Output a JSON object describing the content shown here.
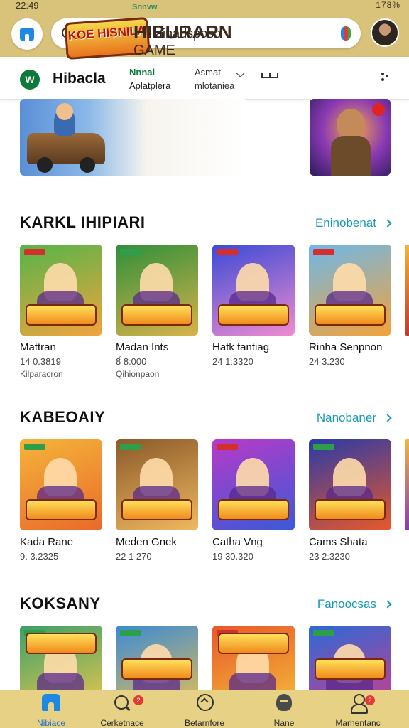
{
  "status": {
    "time": "22:49",
    "battery": "178%"
  },
  "search": {
    "query": "Marketplace ainadsposo"
  },
  "header": {
    "brand": "Hibacla",
    "logo_text": "W",
    "tab1_line1": "Nnnal",
    "tab1_line2": "Aplatplera",
    "tab2_line1": "Asmat",
    "tab2_line2": "mlotaniea"
  },
  "hero": {
    "logo_text": "KOE HISNILA",
    "tag": "Snnvw",
    "title": "HIBURARN",
    "subtitle": "GAME"
  },
  "sections": [
    {
      "title": "KARKL IHIPIARI",
      "link": "Eninobenat",
      "cards": [
        {
          "name": "Mattran",
          "num": "14 0.3819",
          "sub": "Kilparacron",
          "colors": [
            "#53b54a",
            "#f3a33c"
          ]
        },
        {
          "name": "Madan Ints",
          "num": "8́ 8:000",
          "sub": "Qihionpaon",
          "colors": [
            "#2f8f3a",
            "#d8b24a"
          ]
        },
        {
          "name": "Hatk fantiag",
          "num": "24 1:3320",
          "sub": "",
          "colors": [
            "#3a4bd6",
            "#f08bd0"
          ]
        },
        {
          "name": "Rinha Senpnon",
          "num": "24 3.230",
          "sub": "",
          "colors": [
            "#6db8ea",
            "#f4a23a"
          ]
        }
      ]
    },
    {
      "title": "KABEOAIY",
      "link": "Nanobaner",
      "cards": [
        {
          "name": "Kada Rane",
          "num": "9. 3.2325",
          "sub": "",
          "colors": [
            "#f5b43a",
            "#e96a2a"
          ]
        },
        {
          "name": "Meden Gnek",
          "num": "22 1 270",
          "sub": "",
          "colors": [
            "#8a5a2a",
            "#f0b860"
          ]
        },
        {
          "name": "Catha Vng",
          "num": "19 30.320",
          "sub": "",
          "colors": [
            "#b83ac8",
            "#3a5ad6"
          ]
        },
        {
          "name": "Cams Shata",
          "num": "23 2:3230",
          "sub": "",
          "colors": [
            "#2a3aa8",
            "#e8582a"
          ]
        }
      ]
    },
    {
      "title": "KOKSANY",
      "link": "Fanoocsas",
      "cards": [
        {
          "name": "",
          "num": "",
          "sub": "",
          "colors": [
            "#3aa06a",
            "#f5c94a"
          ]
        },
        {
          "name": "",
          "num": "",
          "sub": "",
          "colors": [
            "#3a8ad6",
            "#f2c24a"
          ]
        },
        {
          "name": "",
          "num": "",
          "sub": "",
          "colors": [
            "#e8582a",
            "#f5c23a"
          ]
        },
        {
          "name": "",
          "num": "",
          "sub": "",
          "colors": [
            "#2a6ad6",
            "#d83a8a"
          ]
        }
      ]
    }
  ],
  "bottom_nav": [
    {
      "label": "Nibiace",
      "icon": "home-icon",
      "active": true,
      "badge": ""
    },
    {
      "label": "Cerketnace",
      "icon": "search-icon",
      "active": false,
      "badge": "2"
    },
    {
      "label": "Betarnfore",
      "icon": "explore-icon",
      "active": false,
      "badge": ""
    },
    {
      "label": "Nane",
      "icon": "chat-icon",
      "active": false,
      "badge": ""
    },
    {
      "label": "Marhentanc",
      "icon": "profile-icon",
      "active": false,
      "badge": "2"
    }
  ]
}
